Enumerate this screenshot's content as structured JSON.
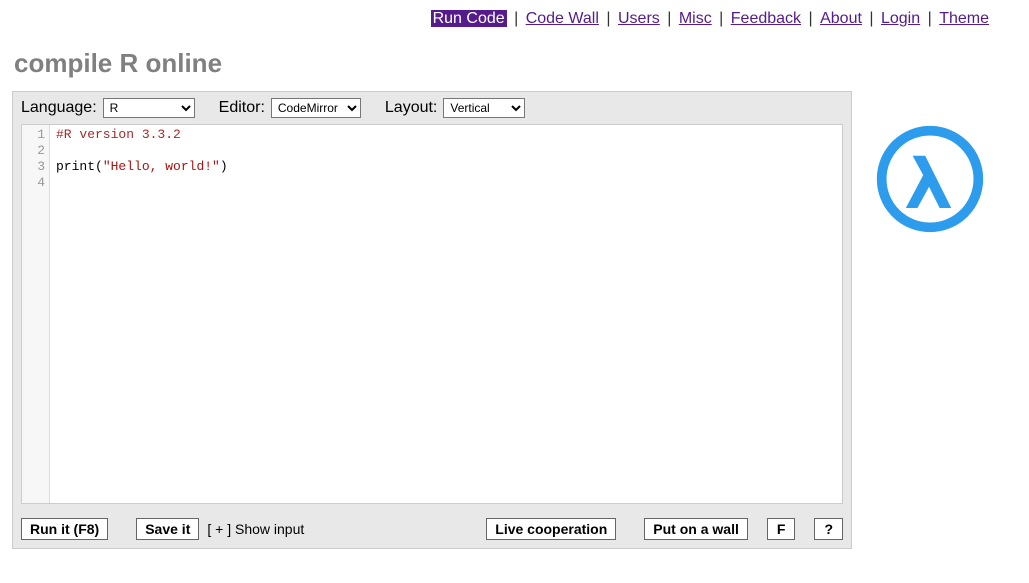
{
  "nav": {
    "items": [
      {
        "label": "Run Code",
        "active": true
      },
      {
        "label": "Code Wall"
      },
      {
        "label": "Users"
      },
      {
        "label": "Misc"
      },
      {
        "label": "Feedback"
      },
      {
        "label": "About"
      },
      {
        "label": "Login"
      },
      {
        "label": "Theme"
      }
    ]
  },
  "title": "compile R online",
  "controls": {
    "language_label": "Language:",
    "language_value": "R",
    "editor_label": "Editor:",
    "editor_value": "CodeMirror",
    "layout_label": "Layout:",
    "layout_value": "Vertical"
  },
  "code": {
    "lines": [
      {
        "n": "1",
        "tokens": [
          {
            "cls": "tok-comment",
            "t": "#R version 3.3.2"
          }
        ]
      },
      {
        "n": "2",
        "tokens": []
      },
      {
        "n": "3",
        "tokens": [
          {
            "cls": "tok-func",
            "t": "print"
          },
          {
            "cls": "tok-paren",
            "t": "("
          },
          {
            "cls": "tok-string",
            "t": "\"Hello, world!\""
          },
          {
            "cls": "tok-paren",
            "t": ")"
          }
        ]
      },
      {
        "n": "4",
        "tokens": []
      }
    ]
  },
  "buttons": {
    "run": "Run it (F8)",
    "save": "Save it",
    "show_input": "[ + ] Show input",
    "live": "Live cooperation",
    "wall": "Put on a wall",
    "f": "F",
    "q": "?"
  }
}
